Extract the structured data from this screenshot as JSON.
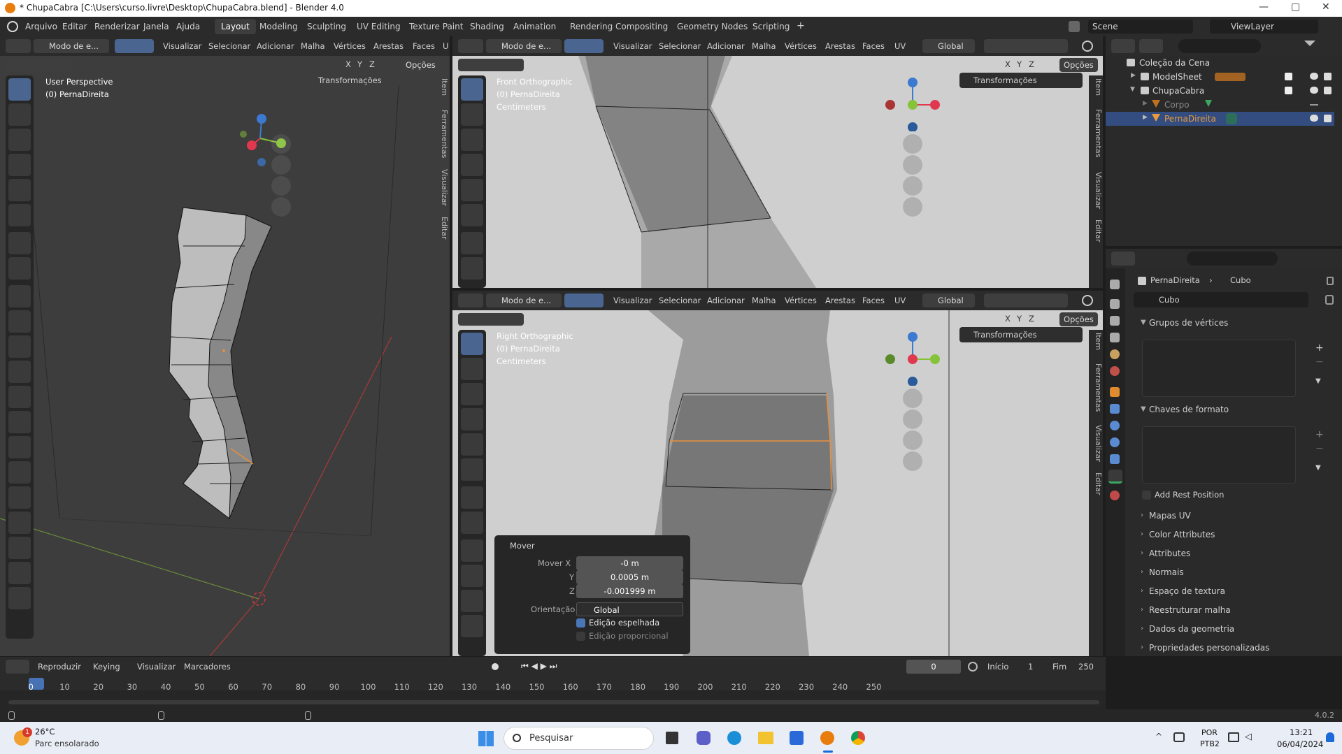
{
  "window": {
    "title": "* ChupaCabra [C:\\Users\\curso.livre\\Desktop\\ChupaCabra.blend] - Blender 4.0",
    "minimize": "—",
    "maximize": "▢",
    "close": "✕"
  },
  "menu": {
    "items": [
      "Arquivo",
      "Editar",
      "Renderizar",
      "Janela",
      "Ajuda"
    ]
  },
  "workspaces": [
    "Layout",
    "Modeling",
    "Sculpting",
    "UV Editing",
    "Texture Paint",
    "Shading",
    "Animation",
    "Rendering",
    "Compositing",
    "Geometry Nodes",
    "Scripting"
  ],
  "workspace_add": "+",
  "scene": {
    "label": "Scene",
    "viewlayer": "ViewLayer"
  },
  "viewport_left": {
    "mode": "Modo de e...",
    "menus": [
      "Visualizar",
      "Selecionar",
      "Adicionar",
      "Malha",
      "Vértices",
      "Arestas",
      "Faces",
      "U"
    ],
    "options": "Opções",
    "axes": [
      "X",
      "Y",
      "Z"
    ],
    "overlay_title": "User Perspective",
    "overlay_object": "(0) PernaDireita",
    "transform_panel": "Transformações",
    "side_tabs": [
      "Item",
      "Ferramentas",
      "Visualizar",
      "Editar"
    ]
  },
  "viewport_front": {
    "mode": "Modo de e...",
    "menus": [
      "Visualizar",
      "Selecionar",
      "Adicionar",
      "Malha",
      "Vértices",
      "Arestas",
      "Faces",
      "UV"
    ],
    "orientation": "Global",
    "options": "Opções",
    "axes": [
      "X",
      "Y",
      "Z"
    ],
    "overlay_title": "Front Orthographic",
    "overlay_object": "(0) PernaDireita",
    "overlay_units": "Centimeters",
    "transform_panel": "Transformações",
    "side_tabs": [
      "Item",
      "Ferramentas",
      "Visualizar",
      "Editar"
    ]
  },
  "viewport_right": {
    "mode": "Modo de e...",
    "menus": [
      "Visualizar",
      "Selecionar",
      "Adicionar",
      "Malha",
      "Vértices",
      "Arestas",
      "Faces",
      "UV"
    ],
    "orientation": "Global",
    "options": "Opções",
    "axes": [
      "X",
      "Y",
      "Z"
    ],
    "overlay_title": "Right Orthographic",
    "overlay_object": "(0) PernaDireita",
    "overlay_units": "Centimeters",
    "transform_panel": "Transformações",
    "side_tabs": [
      "Item",
      "Ferramentas",
      "Visualizar",
      "Editar"
    ]
  },
  "gizmo": {
    "x": "X",
    "y": "Y",
    "z": "Z",
    "x_color": "#e0384f",
    "y_color": "#86c23a",
    "z_color": "#3c7ad1"
  },
  "operator_panel": {
    "title": "Mover",
    "move_x_label": "Mover X",
    "move_x": "-0 m",
    "y_label": "Y",
    "y": "0.0005 m",
    "z_label": "Z",
    "z": "-0.001999 m",
    "orientation_label": "Orientação",
    "orientation": "Global",
    "mirror_label": "Edição espelhada",
    "mirror_checked": true,
    "proportional_label": "Edição proporcional",
    "proportional_checked": false
  },
  "outliner": {
    "root": "Coleção da Cena",
    "items": [
      {
        "name": "ModelSheet",
        "depth": 1
      },
      {
        "name": "ChupaCabra",
        "depth": 1
      },
      {
        "name": "Corpo",
        "depth": 2
      },
      {
        "name": "PernaDireita",
        "depth": 2,
        "selected": true
      }
    ]
  },
  "properties": {
    "breadcrumb_object": "PernaDireita",
    "breadcrumb_data": "Cubo",
    "data_name": "Cubo",
    "vertex_groups": "Grupos de vértices",
    "shape_keys": "Chaves de formato",
    "add_rest_position": "Add Rest Position",
    "sections": [
      "Mapas UV",
      "Color Attributes",
      "Attributes",
      "Normais",
      "Espaço de textura",
      "Reestruturar malha",
      "Dados da geometria",
      "Propriedades personalizadas"
    ]
  },
  "timeline": {
    "menus": [
      "Reproduzir",
      "Keying",
      "Visualizar",
      "Marcadores"
    ],
    "current_frame": "0",
    "start_label": "Início",
    "start": "1",
    "end_label": "Fim",
    "end": "250",
    "ticks": [
      "0",
      "10",
      "20",
      "30",
      "40",
      "50",
      "60",
      "70",
      "80",
      "90",
      "100",
      "110",
      "120",
      "130",
      "140",
      "150",
      "160",
      "170",
      "180",
      "190",
      "200",
      "210",
      "220",
      "230",
      "240",
      "250"
    ]
  },
  "statusbar": {
    "version": "4.0.2"
  },
  "taskbar": {
    "weather_temp": "26°C",
    "weather_desc": "Parc ensolarado",
    "weather_badge": "1",
    "search": "Pesquisar",
    "lang1": "POR",
    "lang2": "PTB2",
    "time": "13:21",
    "date": "06/04/2024"
  }
}
